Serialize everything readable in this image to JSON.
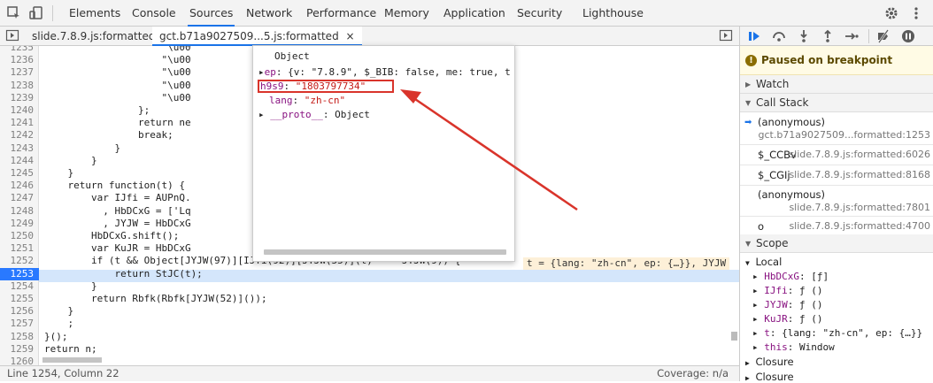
{
  "tabs": [
    "Elements",
    "Console",
    "Sources",
    "Network",
    "Performance",
    "Memory",
    "Application",
    "Security",
    "Lighthouse"
  ],
  "files": {
    "file1": "slide.7.8.9.js:formatted",
    "file2": "gct.b71a9027509...5.js:formatted",
    "close": "×"
  },
  "lines": [
    "1235",
    "1236",
    "1237",
    "1238",
    "1239",
    "1240",
    "1241",
    "1242",
    "1243",
    "1244",
    "1245",
    "1246",
    "1247",
    "1248",
    "1249",
    "1250",
    "1251",
    "1252",
    "1253",
    "1254",
    "1255",
    "1256",
    "1257",
    "1258",
    "1259",
    "1260"
  ],
  "code": [
    "                    \"\\u00",
    "                    \"\\u00",
    "                    \"\\u00",
    "                    \"\\u00",
    "                    \"\\u00",
    "                };",
    "                return ne",
    "                break;",
    "            }",
    "        }",
    "    }",
    "    return function(t) {",
    "        var IJfi = AUPnQ.",
    "          , HbDCxG = ['Lq",
    "          , JYJW = HbDCxG",
    "        HbDCxG.shift();",
    "        var KuJR = HbDCxG",
    "        if (t && Object[JYJW(97)][IJfi(92)][JYJW(55)](t) === JYJW(9)) {",
    "            return StJC(t);",
    "        }",
    "        return Rbfk(Rbfk[JYJW(52)]());",
    "    }",
    "    ;",
    "}();",
    "return n;",
    ""
  ],
  "inline_value": "t = {lang: \"zh-cn\", ep: {…}}, JYJW",
  "popover": {
    "title": "Object",
    "ep_key": "ep",
    "ep_value": "{v: \"7.8.9\", $_BIB: false, me: true, t",
    "h9s9_key": "h9s9",
    "h9s9_value": "\"1803797734\"",
    "lang_key": "lang",
    "lang_value": "\"zh-cn\"",
    "proto_key": "__proto__",
    "proto_value": "Object"
  },
  "status": {
    "position": "Line 1254, Column 22",
    "coverage": "Coverage: n/a"
  },
  "debugger": {
    "paused_text": "Paused on breakpoint",
    "watch": "Watch",
    "callstack": "Call Stack",
    "frames": [
      {
        "name": "(anonymous)",
        "loc": "gct.b71a9027509...formatted:1253"
      },
      {
        "name": "$_CCBv",
        "loc": "slide.7.8.9.js:formatted:6026"
      },
      {
        "name": "$_CGIj",
        "loc": "slide.7.8.9.js:formatted:8168"
      },
      {
        "name": "(anonymous)",
        "loc": "slide.7.8.9.js:formatted:7801"
      },
      {
        "name": "o",
        "loc": "slide.7.8.9.js:formatted:4700"
      }
    ],
    "scope": "Scope",
    "local": "Local",
    "vars": [
      {
        "k": "HbDCxG",
        "v": "[ƒ]"
      },
      {
        "k": "IJfi",
        "v": "ƒ ()"
      },
      {
        "k": "JYJW",
        "v": "ƒ ()"
      },
      {
        "k": "KuJR",
        "v": "ƒ ()"
      },
      {
        "k": "t",
        "v": "{lang: \"zh-cn\", ep: {…}}"
      },
      {
        "k": "this",
        "v": "Window"
      }
    ],
    "closure1": "Closure",
    "closure2": "Closure"
  },
  "colors": {
    "accent": "#1a73e8",
    "annotation": "#d9342b",
    "paused_bg": "#fffbe5"
  }
}
